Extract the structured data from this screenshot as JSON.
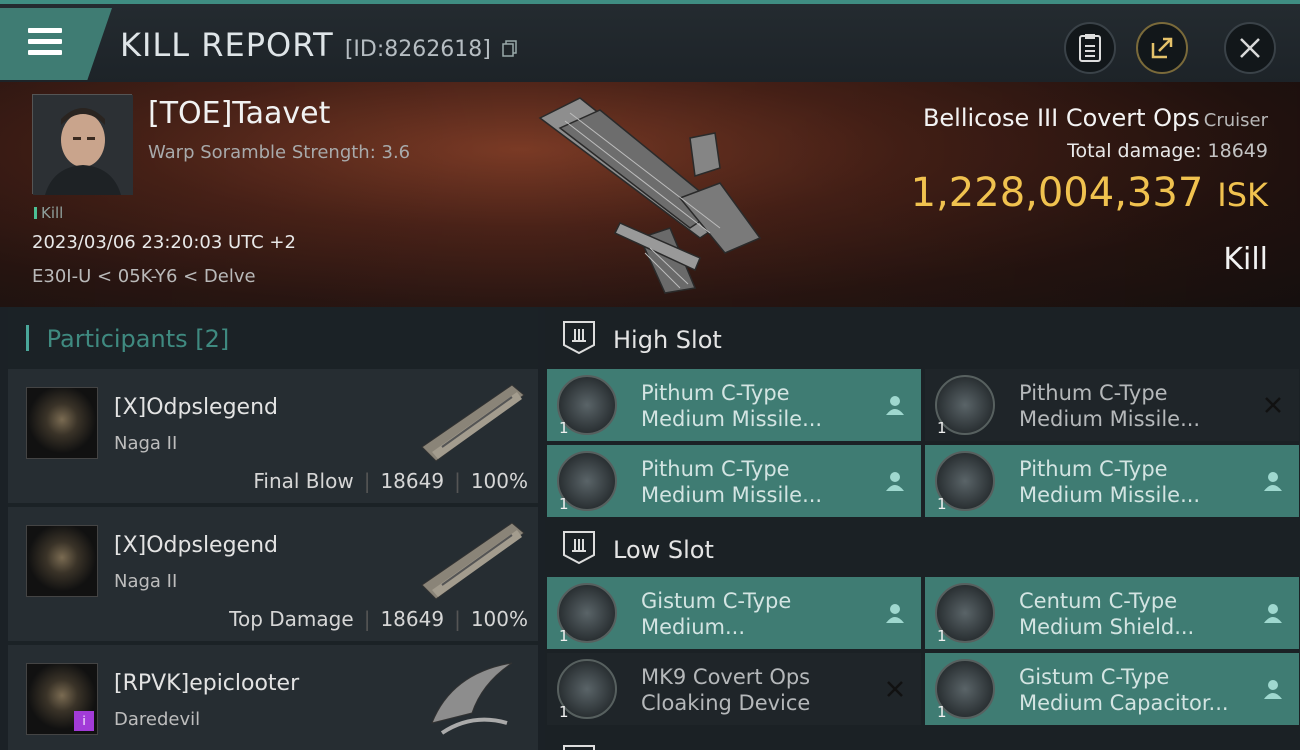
{
  "header": {
    "title": "KILL REPORT",
    "id_label": "[ID:8262618]"
  },
  "victim": {
    "name": "[TOE]Taavet",
    "warp_scramble": "Warp Soramble Strength: 3.6",
    "kill_tag": "Kill",
    "datetime": "2023/03/06 23:20:03 UTC +2",
    "location": "E30I-U < 05K-Y6 < Delve",
    "ship": "Bellicose III Covert Ops",
    "ship_class": "Cruiser",
    "total_damage_label": "Total damage:",
    "total_damage": "18649",
    "isk_value": "1,228,004,337",
    "isk_unit": "ISK",
    "result": "Kill"
  },
  "participants": {
    "title": "Participants",
    "count": "[2]",
    "items": [
      {
        "name": "[X]Odpslegend",
        "ship": "Naga II",
        "role": "Final Blow",
        "damage": "18649",
        "percent": "100%"
      },
      {
        "name": "[X]Odpslegend",
        "ship": "Naga II",
        "role": "Top Damage",
        "damage": "18649",
        "percent": "100%"
      },
      {
        "name": "[RPVK]epiclooter",
        "ship": "Daredevil",
        "badge": "i"
      }
    ]
  },
  "high_slot": {
    "label": "High Slot",
    "items": [
      {
        "qty": "1",
        "line1": "Pithum C-Type",
        "line2": "Medium Missile...",
        "state": "user-icon"
      },
      {
        "qty": "1",
        "line1": "Pithum C-Type",
        "line2": "Medium Missile...",
        "state": "close-icon"
      },
      {
        "qty": "1",
        "line1": "Pithum C-Type",
        "line2": "Medium Missile...",
        "state": "user-icon"
      },
      {
        "qty": "1",
        "line1": "Pithum C-Type",
        "line2": "Medium Missile...",
        "state": "user-icon"
      }
    ]
  },
  "low_slot": {
    "label": "Low Slot",
    "items": [
      {
        "qty": "1",
        "line1": "Gistum C-Type",
        "line2": "Medium...",
        "state": "user-icon"
      },
      {
        "qty": "1",
        "line1": "Centum C-Type",
        "line2": "Medium Shield...",
        "state": "user-icon"
      },
      {
        "qty": "1",
        "line1": "MK9 Covert Ops",
        "line2": "Cloaking Device",
        "state": "close-icon"
      },
      {
        "qty": "1",
        "line1": "Gistum C-Type",
        "line2": "Medium Capacitor...",
        "state": "user-icon"
      }
    ]
  },
  "colors": {
    "accent": "#3f7c73",
    "isk": "#f0c24f",
    "background": "#1b2126"
  }
}
